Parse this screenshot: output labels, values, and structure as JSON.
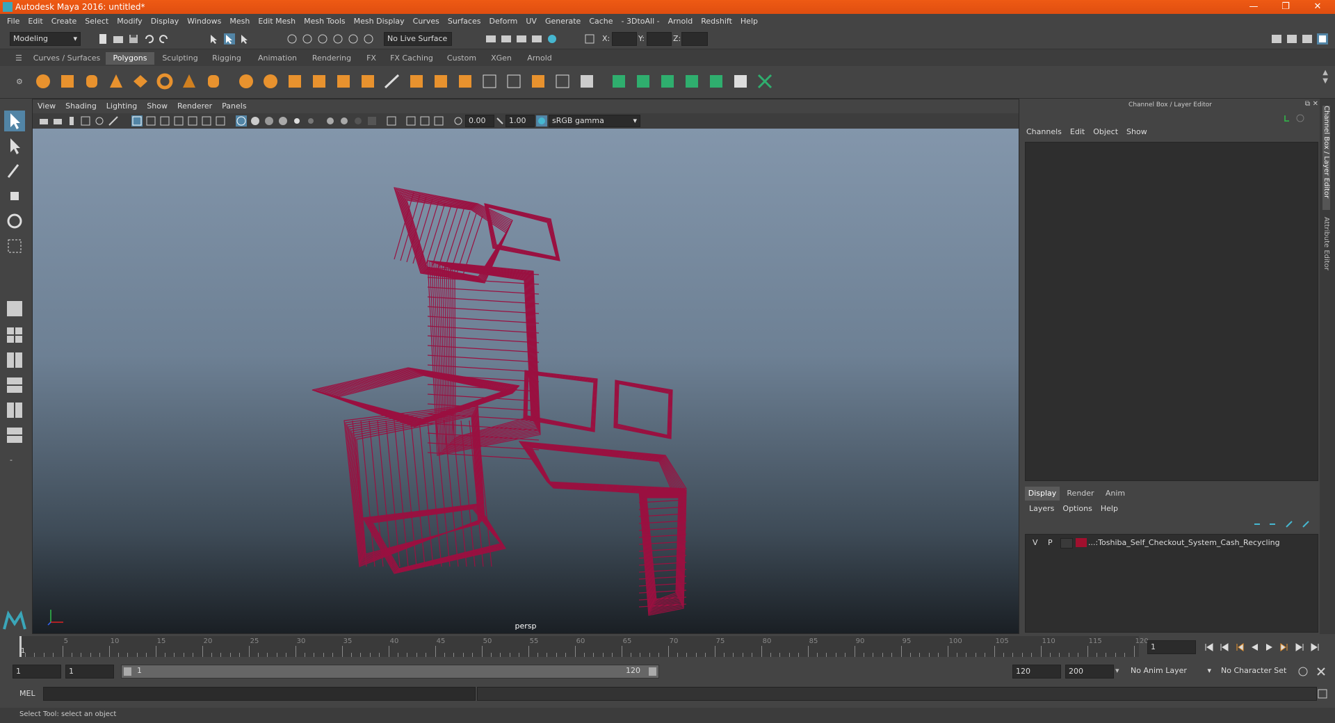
{
  "window": {
    "title": "Autodesk Maya 2016: untitled*",
    "min": "—",
    "max": "❐",
    "close": "✕"
  },
  "menubar": [
    "File",
    "Edit",
    "Create",
    "Select",
    "Modify",
    "Display",
    "Windows",
    "Mesh",
    "Edit Mesh",
    "Mesh Tools",
    "Mesh Display",
    "Curves",
    "Surfaces",
    "Deform",
    "UV",
    "Generate",
    "Cache",
    "- 3DtoAll -",
    "Arnold",
    "Redshift",
    "Help"
  ],
  "statusline": {
    "menuset": "Modeling",
    "live_surface": "No Live Surface",
    "x_label": "X:",
    "y_label": "Y:",
    "z_label": "Z:"
  },
  "shelf": {
    "tabs": [
      "Curves / Surfaces",
      "Polygons",
      "Sculpting",
      "Rigging",
      "Animation",
      "Rendering",
      "FX",
      "FX Caching",
      "Custom",
      "XGen",
      "Arnold"
    ],
    "active_tab": "Polygons"
  },
  "viewport": {
    "menu": [
      "View",
      "Shading",
      "Lighting",
      "Show",
      "Renderer",
      "Panels"
    ],
    "exposure": "0.00",
    "gamma": "1.00",
    "colorspace": "sRGB gamma",
    "camera_label": "persp",
    "wire_color": "#9a1040"
  },
  "channelbox": {
    "title": "Channel Box / Layer Editor",
    "menu": [
      "Channels",
      "Edit",
      "Object",
      "Show"
    ]
  },
  "layers": {
    "tabs": [
      "Display",
      "Render",
      "Anim"
    ],
    "active_tab": "Display",
    "menu": [
      "Layers",
      "Options",
      "Help"
    ],
    "rows": [
      {
        "v": "V",
        "p": "P",
        "name": "...:Toshiba_Self_Checkout_System_Cash_Recycling",
        "color": "#a0102e"
      }
    ]
  },
  "side_tabs": {
    "channel_box": "Channel Box / Layer Editor",
    "attr_editor": "Attribute Editor"
  },
  "timeline": {
    "labels": [
      "5",
      "10",
      "15",
      "20",
      "25",
      "30",
      "35",
      "40",
      "45",
      "50",
      "55",
      "60",
      "65",
      "70",
      "75",
      "80",
      "85",
      "90",
      "95",
      "100",
      "105",
      "110",
      "115",
      "120"
    ],
    "current_frame_marker": "1",
    "current_frame": "1"
  },
  "range": {
    "start": "1",
    "anim_start": "1",
    "slider_start": "1",
    "slider_end": "120",
    "anim_end": "120",
    "end": "200",
    "anim_layer": "No Anim Layer",
    "char_set": "No Character Set"
  },
  "cmd": {
    "label": "MEL"
  },
  "help": {
    "text": "Select Tool: select an object"
  }
}
